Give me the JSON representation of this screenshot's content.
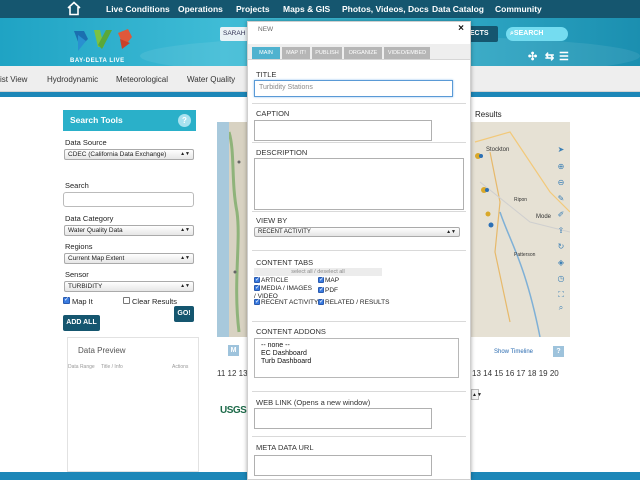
{
  "nav": {
    "items": [
      "Live Conditions",
      "Operations",
      "Projects",
      "Maps & GIS",
      "Photos, Videos, Docs",
      "Data Catalog",
      "Community"
    ]
  },
  "banner": {
    "logo_text": "BAY-DELTA LIVE",
    "user": "SARAH",
    "projects_label": "JECTS",
    "search_label": "SEARCH"
  },
  "subtabs": [
    "ist View",
    "Hydrodynamic",
    "Meteorological",
    "Water Quality"
  ],
  "search_tools": {
    "title": "Search Tools",
    "help": "?",
    "data_source_label": "Data Source",
    "data_source_value": "CDEC (California Data Exchange)",
    "search_label": "Search",
    "data_category_label": "Data Category",
    "data_category_value": "Water Quality Data",
    "regions_label": "Regions",
    "regions_value": "Current Map Extent",
    "sensor_label": "Sensor",
    "sensor_value": "TURBIDITY",
    "map_it_label": "Map It",
    "map_it_checked": true,
    "clear_results_label": "Clear Results",
    "clear_results_checked": false,
    "go_label": "GO!",
    "add_all_label": "ADD ALL"
  },
  "data_preview": {
    "title": "Data Preview",
    "columns": [
      "Data Range",
      "Title / Info",
      "Actions"
    ]
  },
  "map": {
    "results_label": "Results",
    "places": [
      "Stockton",
      "Ripon",
      "Mode",
      "Patterson"
    ],
    "m_button": "M",
    "show_timeline": "Show Timeline",
    "help_button": "?",
    "timeline_left": "11 12 13",
    "timeline_right": "13 14 15 16 17 18 19 20",
    "usgs": "USGS"
  },
  "modal": {
    "title": "NEW",
    "close": "×",
    "tabs": [
      "MAIN",
      "MAP IT!",
      "PUBLISH",
      "ORGANIZE",
      "VIDEO/EMBED"
    ],
    "active_tab": "MAIN",
    "title_label": "TITLE",
    "title_value": "Turbidity Stations",
    "caption_label": "CAPTION",
    "description_label": "DESCRIPTION",
    "view_by_label": "VIEW BY",
    "view_by_value": "RECENT ACTIVITY",
    "content_tabs_label": "CONTENT TABS",
    "select_all": "select all / deselect all",
    "content_tabs": [
      {
        "label": "ARTICLE",
        "checked": true
      },
      {
        "label": "MAP",
        "checked": true
      },
      {
        "label": "MEDIA / IMAGES / VIDEO",
        "checked": true
      },
      {
        "label": "PDF",
        "checked": true
      },
      {
        "label": "RECENT ACTIVITY",
        "checked": true
      },
      {
        "label": "RELATED / RESULTS",
        "checked": true
      }
    ],
    "content_addons_label": "CONTENT ADDONS",
    "addons": [
      "-- none --",
      "EC Dashboard",
      "Turb Dashboard"
    ],
    "web_link_label": "WEB LINK (Opens a new window)",
    "meta_data_label": "META DATA URL"
  },
  "colors": {
    "nav_bg": "#15566f",
    "banner": "#2fb0cc",
    "accent": "#2ab0c9",
    "button": "#15566f",
    "tab_active": "#4fb2cf",
    "tab_inactive": "#b6b6b6"
  }
}
